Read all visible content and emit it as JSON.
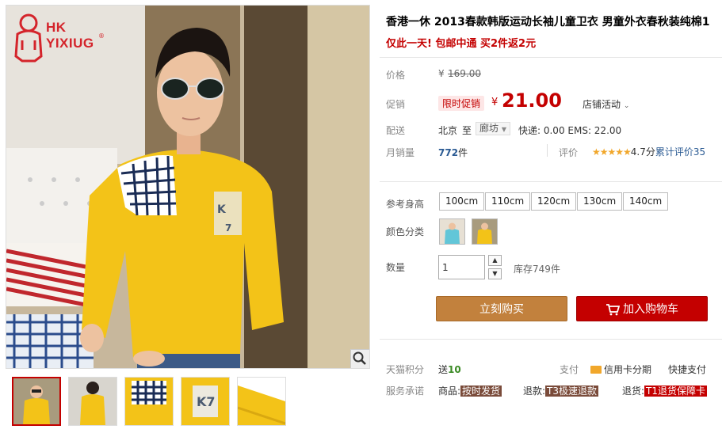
{
  "brand": {
    "logo_line1": "HK",
    "logo_line2": "YIXIUG",
    "logo_mark": "®",
    "brand_color": "#d4242b"
  },
  "gallery": {
    "zoom_icon": "magnifier-icon",
    "thumbnail_count": 5
  },
  "product": {
    "title": "香港一休 2013春款韩版运动长袖儿童卫衣 男童外衣春秋装纯棉1",
    "subtitle": "仅此一天! 包邮中通 买2件返2元"
  },
  "meta": {
    "price_label": "价格",
    "original_price": "169.00",
    "currency": "¥",
    "promo_label": "促销",
    "promo_tag": "限时促销",
    "promo_price": "21.00",
    "store_promo": "店铺活动",
    "shipping_label": "配送",
    "ship_from": "北京",
    "ship_to_word": "至",
    "ship_to": "廊坊",
    "shipping_fees": "快递: 0.00 EMS: 22.00",
    "monthly_sales_label": "月销量",
    "monthly_sales_value": "772",
    "monthly_sales_unit": "件",
    "rating_label": "评价",
    "rating_stars": "★★★★★",
    "rating_score": "4.7分",
    "rating_total": "累计评价35"
  },
  "options": {
    "size_label": "参考身高",
    "sizes": [
      "100cm",
      "110cm",
      "120cm",
      "130cm",
      "140cm"
    ],
    "color_label": "颜色分类",
    "qty_label": "数量",
    "qty_value": "1",
    "stock_text": "库存749件"
  },
  "actions": {
    "buy_now": "立刻购买",
    "add_to_cart": "加入购物车"
  },
  "footer": {
    "points_label": "天猫积分",
    "points_prefix": "送",
    "points_value": "10",
    "pay_label": "支付",
    "pay_credit": "信用卡分期",
    "pay_quick": "快捷支付",
    "service_label": "服务承诺",
    "service_goods": "商品:",
    "service_goods_badge": "按时发货",
    "service_refund": "退款:",
    "service_refund_badge": "T3极速退款",
    "service_return": "退货:",
    "service_return_badge": "T1退货保障卡"
  }
}
